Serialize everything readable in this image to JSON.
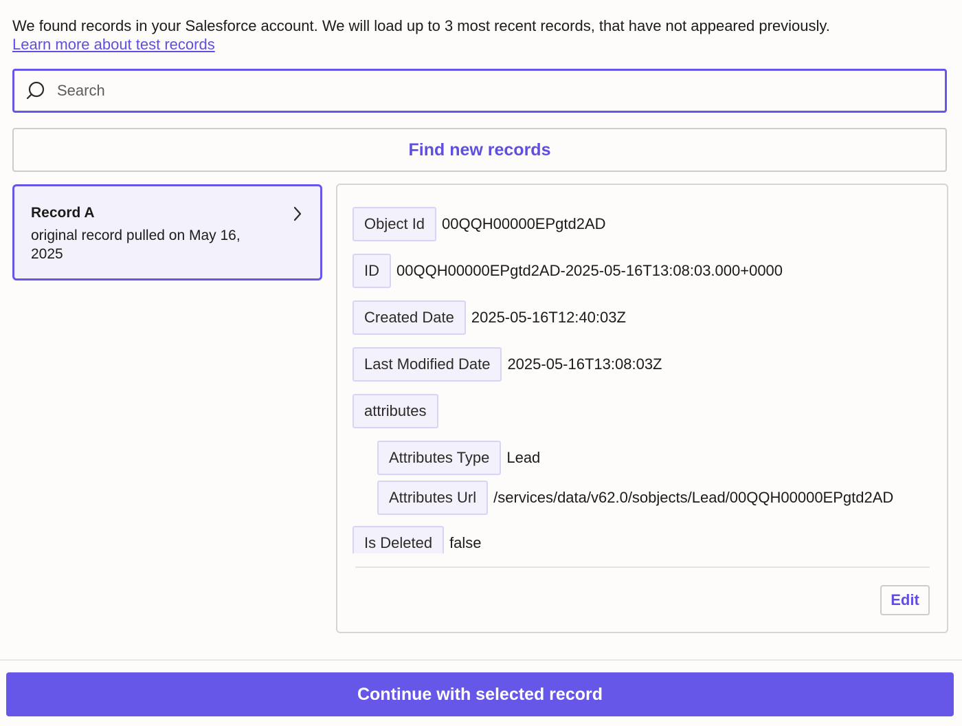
{
  "intro": {
    "text": "We found records in your Salesforce account. We will load up to 3 most recent records, that have not appeared previously.",
    "link": "Learn more about test records"
  },
  "search": {
    "placeholder": "Search",
    "icon": "search-icon"
  },
  "find_button": {
    "label": "Find new records"
  },
  "records": [
    {
      "title": "Record A",
      "subtitle": "original record pulled on May 16, 2025",
      "selected": true
    }
  ],
  "details": {
    "fields": [
      {
        "key": "Object Id",
        "value": "00QQH00000EPgtd2AD"
      },
      {
        "key": "ID",
        "value": "00QQH00000EPgtd2AD-2025-05-16T13:08:03.000+0000"
      },
      {
        "key": "Created Date",
        "value": "2025-05-16T12:40:03Z"
      },
      {
        "key": "Last Modified Date",
        "value": "2025-05-16T13:08:03Z"
      },
      {
        "key": "attributes",
        "value": ""
      },
      {
        "key": "Attributes Type",
        "value": "Lead"
      },
      {
        "key": "Attributes Url",
        "value": "/services/data/v62.0/sobjects/Lead/00QQH00000EPgtd2AD"
      },
      {
        "key": "Is Deleted",
        "value": "false"
      }
    ],
    "edit_label": "Edit"
  },
  "continue_button": {
    "label": "Continue with selected record"
  },
  "colors": {
    "accent": "#6657e8",
    "link": "#5f4fe0",
    "selected_card_bg": "#f3f1fb"
  }
}
